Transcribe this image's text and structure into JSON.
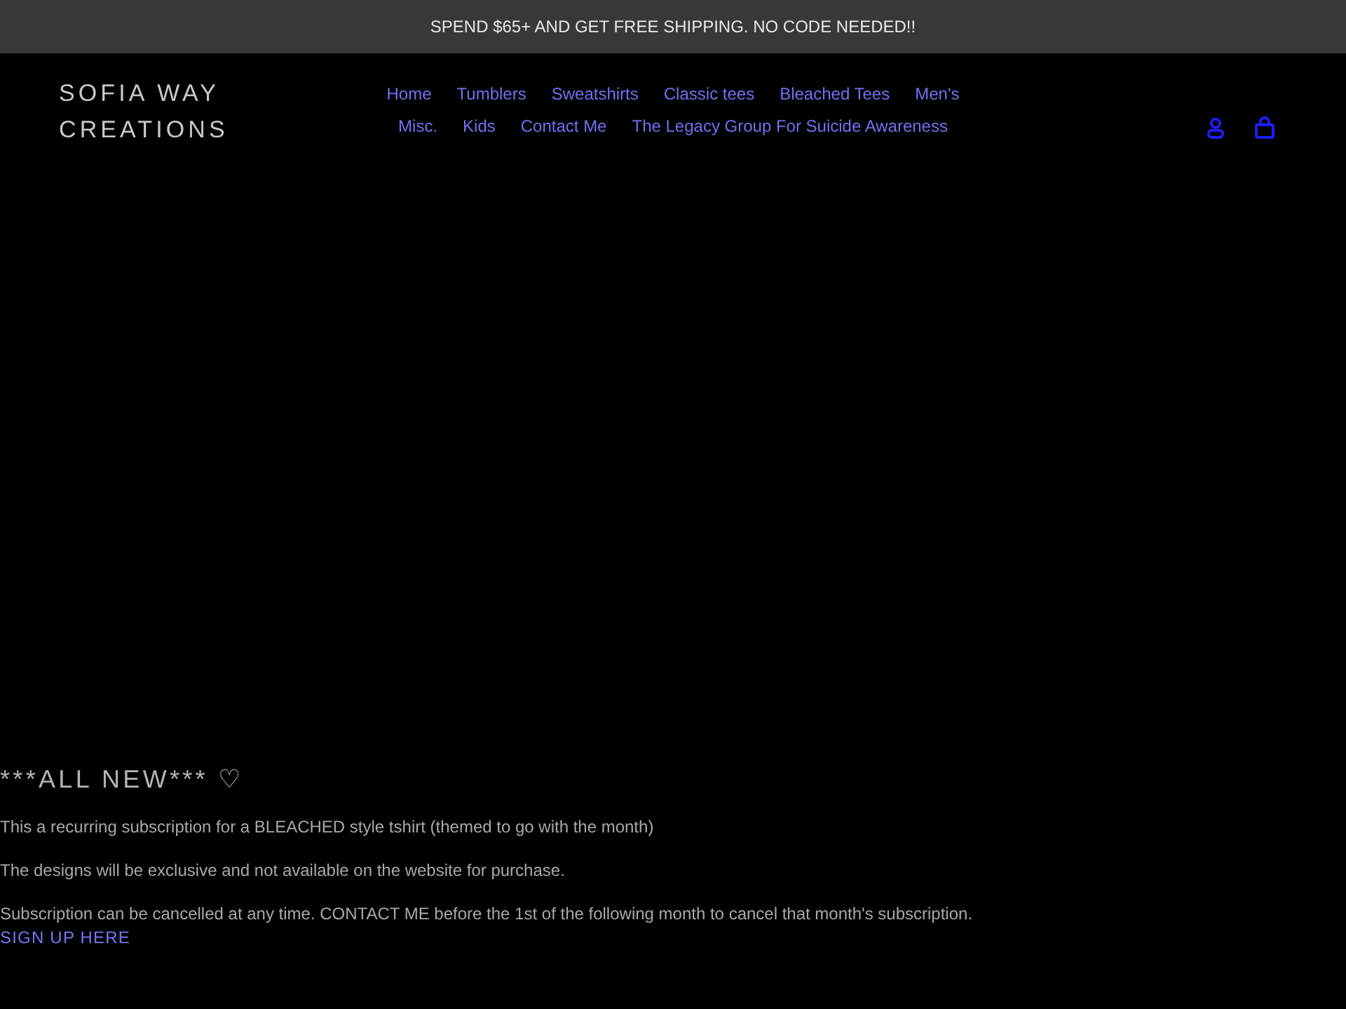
{
  "announcement": {
    "text": "SPEND $65+ AND GET FREE SHIPPING. NO CODE NEEDED!!"
  },
  "header": {
    "logo_lines": [
      "SOFIA WAY",
      "CREATIONS"
    ],
    "nav": [
      "Home",
      "Tumblers",
      "Sweatshirts",
      "Classic tees",
      "Bleached Tees",
      "Men's",
      "Misc.",
      "Kids",
      "Contact Me",
      "The Legacy Group For Suicide Awareness"
    ]
  },
  "content": {
    "heading": "***ALL NEW*** ♡",
    "paragraphs": [
      "This a recurring subscription for a BLEACHED style tshirt (themed to go with the month)",
      "The designs will be exclusive and not available on the website for purchase.",
      "Subscription can be cancelled at any time. CONTACT ME before the 1st of the following month to cancel that month's subscription."
    ],
    "link": "SIGN UP HERE"
  }
}
